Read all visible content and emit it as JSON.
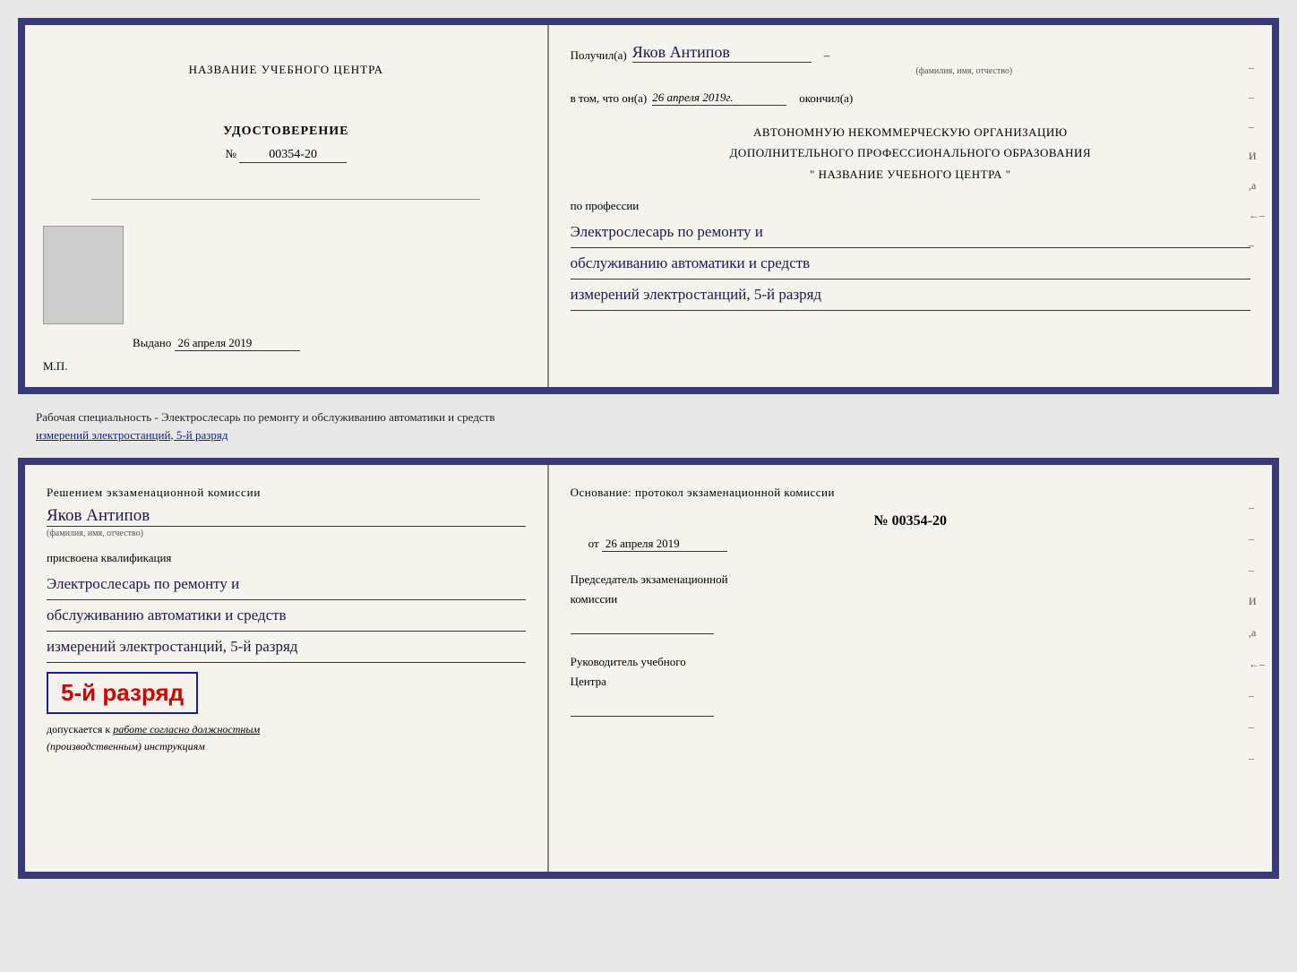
{
  "top_doc": {
    "left": {
      "center_title": "НАЗВАНИЕ УЧЕБНОГО ЦЕНТРА",
      "udostoverenie_title": "УДОСТОВЕРЕНИЕ",
      "number_label": "№",
      "number_value": "00354-20",
      "vydano_label": "Выдано",
      "vydano_date": "26 апреля 2019",
      "mp_label": "М.П."
    },
    "right": {
      "poluchil_label": "Получил(а)",
      "handwritten_name": "Яков Антипов",
      "fio_hint": "(фамилия, имя, отчество)",
      "vtom_label": "в том, что он(а)",
      "vtom_date": "26 апреля 2019г.",
      "okonchil_label": "окончил(а)",
      "org_line1": "АВТОНОМНУЮ НЕКОММЕРЧЕСКУЮ ОРГАНИЗАЦИЮ",
      "org_line2": "ДОПОЛНИТЕЛЬНОГО ПРОФЕССИОНАЛЬНОГО ОБРАЗОВАНИЯ",
      "org_line3": "\"   НАЗВАНИЕ УЧЕБНОГО ЦЕНТРА   \"",
      "po_professii": "по профессии",
      "profession_line1": "Электрослесарь по ремонту и",
      "profession_line2": "обслуживанию автоматики и средств",
      "profession_line3": "измерений электростанций, 5-й разряд",
      "dashes": [
        "-",
        "-",
        "-",
        "И",
        ",а",
        "←",
        "-"
      ]
    }
  },
  "middle": {
    "text_line1": "Рабочая специальность - Электрослесарь по ремонту и обслуживанию автоматики и средств",
    "text_line2": "измерений электростанций, 5-й разряд"
  },
  "bottom_doc": {
    "left": {
      "resheniem_label": "Решением  экзаменационной  комиссии",
      "handwritten_name": "Яков Антипов",
      "fio_hint": "(фамилия, имя, отчество)",
      "prisvoena": "присвоена квалификация",
      "profession_line1": "Электрослесарь по ремонту и",
      "profession_line2": "обслуживанию автоматики и средств",
      "profession_line3": "измерений электростанций, 5-й разряд",
      "razryad_badge": "5-й разряд",
      "dopuskaetsya_label": "допускается к",
      "dopuskaetsya_value": "работе согласно должностным",
      "dopuskaetsya_value2": "(производственным) инструкциям"
    },
    "right": {
      "osnovanie_label": "Основание:  протокол  экзаменационной  комиссии",
      "protocol_number": "№  00354-20",
      "ot_label": "от",
      "ot_date": "26 апреля 2019",
      "predsedatel_line1": "Председатель экзаменационной",
      "predsedatel_line2": "комиссии",
      "rukovoditel_line1": "Руководитель учебного",
      "rukovoditel_line2": "Центра",
      "dashes": [
        "-",
        "-",
        "-",
        "И",
        ",а",
        "←",
        "-",
        "-",
        "-"
      ]
    }
  }
}
